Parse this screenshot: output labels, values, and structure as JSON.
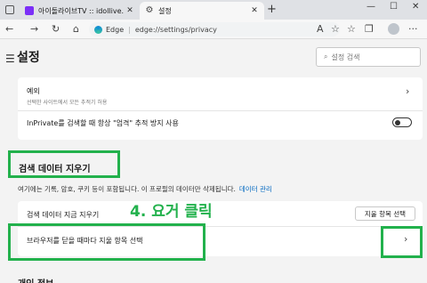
{
  "tabs": [
    {
      "label": "아이돌라이브TV :: idollive.tv",
      "favicon": "purple-square-icon"
    },
    {
      "label": "설정",
      "favicon": "gear-icon",
      "active": true
    }
  ],
  "address_bar": {
    "brand": "Edge",
    "separator": "|",
    "url": "edge://settings/privacy"
  },
  "header": {
    "title": "설정",
    "search_placeholder": "설정 검색"
  },
  "privacy_card": {
    "exception_title": "예외",
    "exception_sub": "선택한 사이트에서 모든 추적기 허용",
    "inprivate_label": "InPrivate를 검색할 때 항상 \"엄격\" 추적 방지 사용",
    "inprivate_toggle": false
  },
  "clear_section": {
    "heading": "검색 데이터 지우기",
    "description": "여기에는 기록, 암호, 쿠키 등이 포함됩니다. 이 프로필의 데이터만 삭제됩니다.",
    "manage_link": "데이터 관리",
    "clear_now_label": "검색 데이터 지금 지우기",
    "choose_button": "지울 항목 선택",
    "on_close_label": "브라우저를 닫을 때마다 지울 항목 선택"
  },
  "next_heading": "개인 정보",
  "annotation": "4. 요거 클릭",
  "colors": {
    "highlight": "#22b14c",
    "link": "#0067c0"
  }
}
